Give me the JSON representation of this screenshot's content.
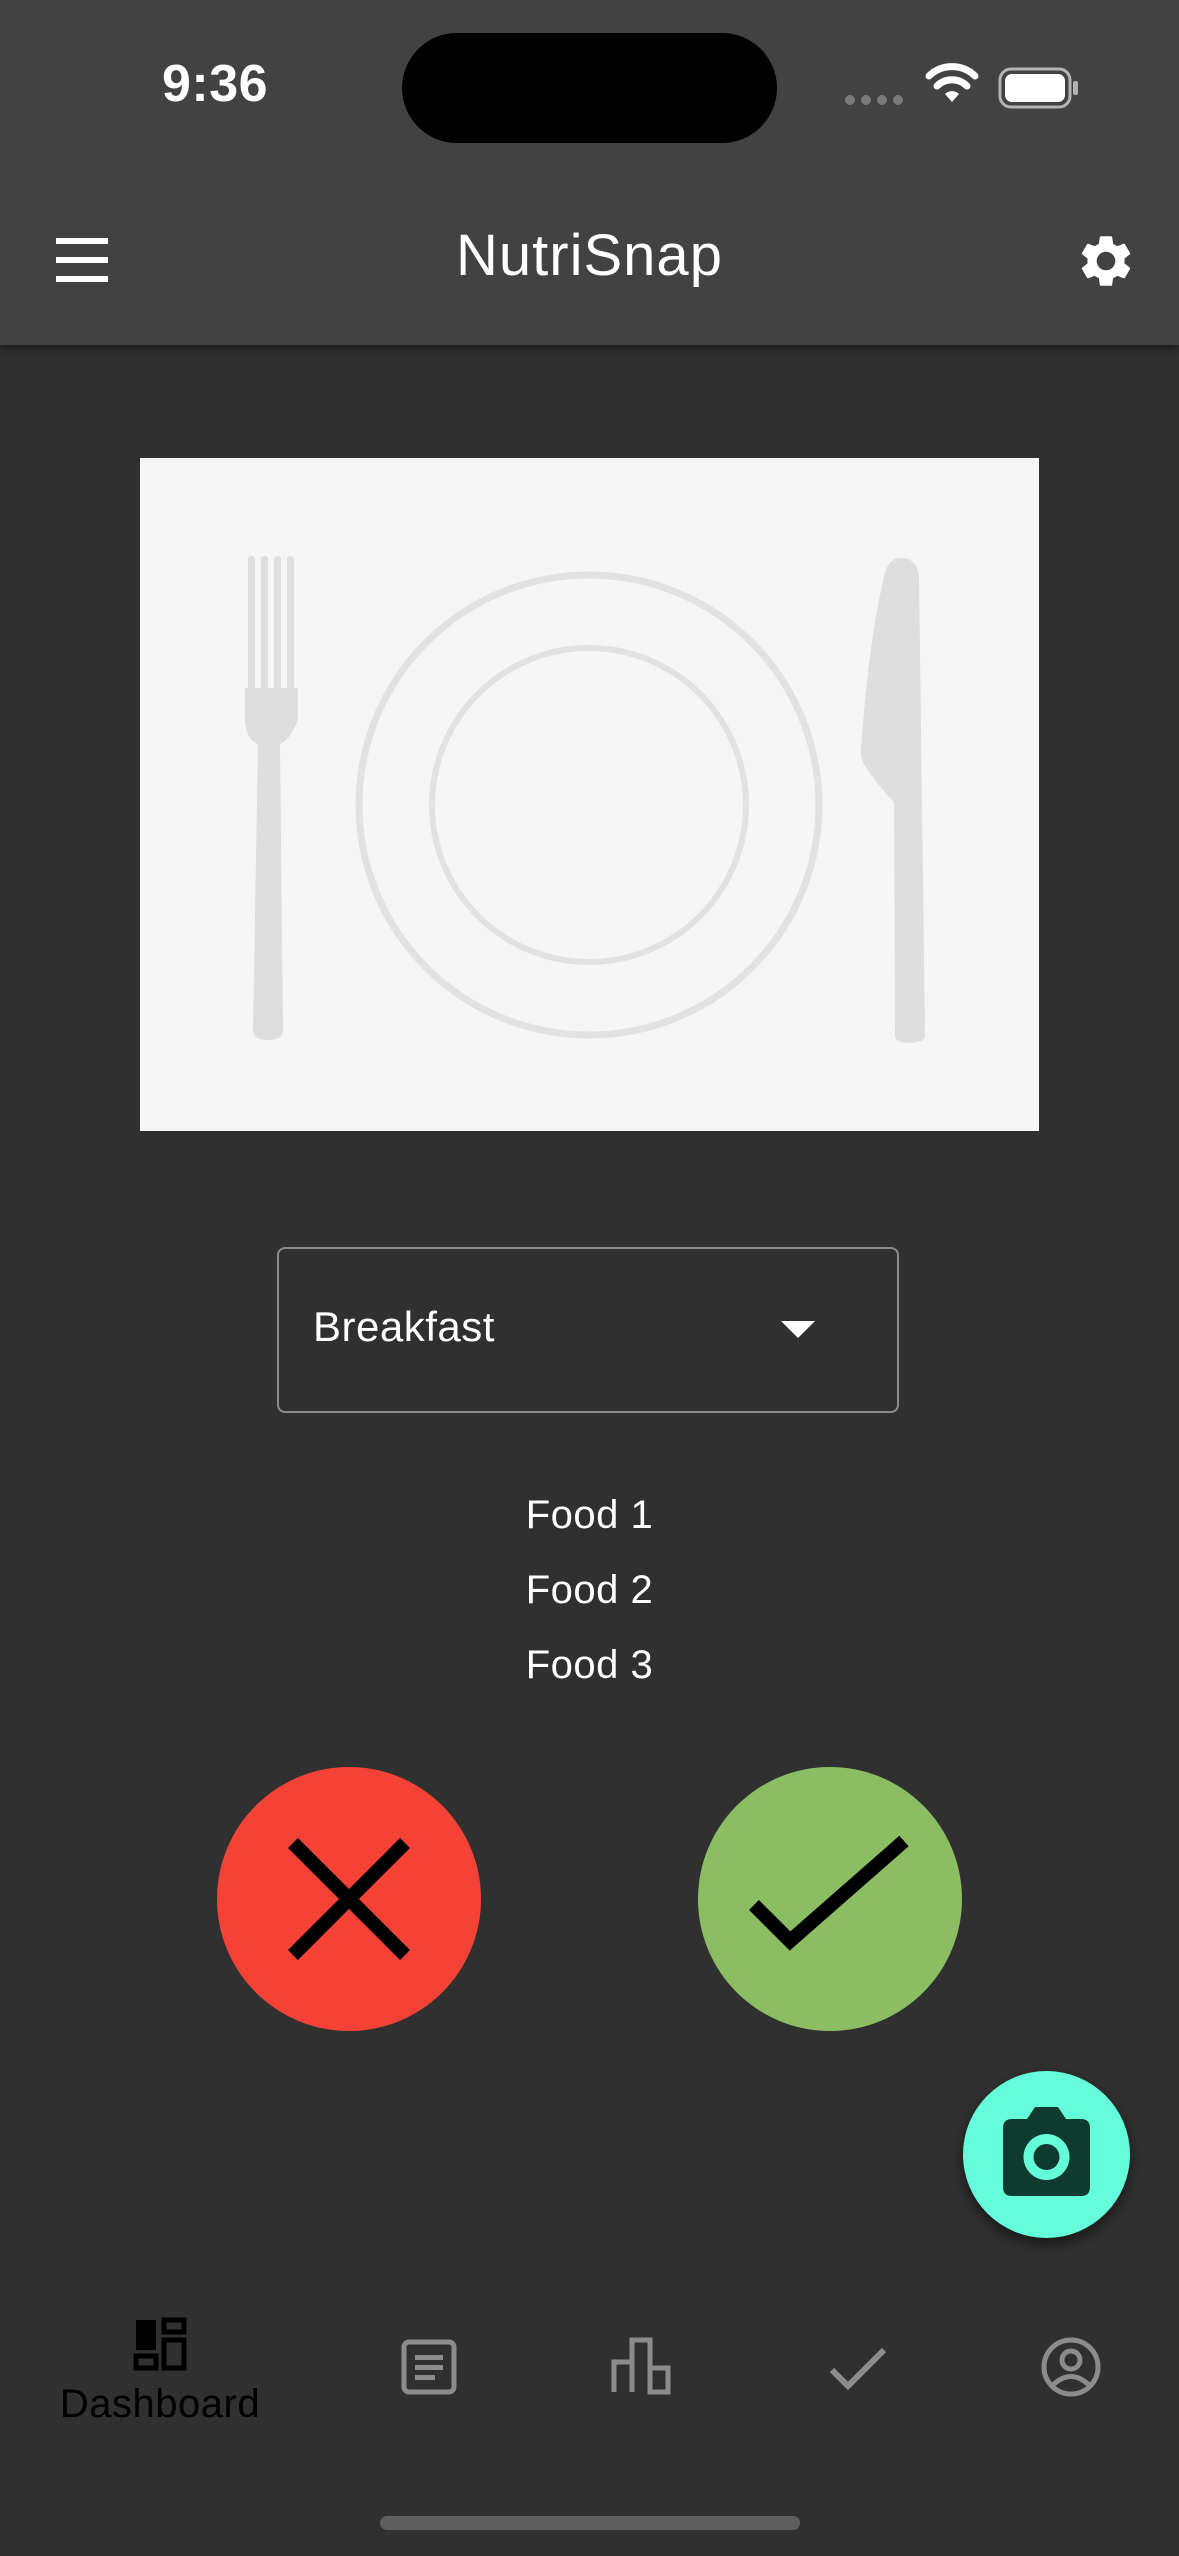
{
  "status_bar": {
    "time": "9:36"
  },
  "app_bar": {
    "title": "NutriSnap",
    "menu_icon": "hamburger-menu-icon",
    "settings_icon": "gear-icon"
  },
  "meal_photo": {
    "icon": "plate-fork-knife-placeholder"
  },
  "meal_selector": {
    "selected": "Breakfast"
  },
  "detected_foods": [
    "Food 1",
    "Food 2",
    "Food 3"
  ],
  "actions": {
    "reject_icon": "close-icon",
    "accept_icon": "check-icon",
    "reject_color": "#f44336",
    "accept_color": "#8bbd62"
  },
  "camera_fab": {
    "icon": "camera-icon",
    "color": "#64ffda"
  },
  "bottom_nav": {
    "items": [
      {
        "label": "Dashboard",
        "icon": "dashboard-icon",
        "active": true
      },
      {
        "label": "",
        "icon": "article-icon",
        "active": false
      },
      {
        "label": "",
        "icon": "bar-chart-icon",
        "active": false
      },
      {
        "label": "",
        "icon": "check-icon",
        "active": false
      },
      {
        "label": "",
        "icon": "account-circle-icon",
        "active": false
      }
    ]
  },
  "colors": {
    "background": "#303030",
    "app_bar": "#424242",
    "accent": "#64ffda"
  }
}
